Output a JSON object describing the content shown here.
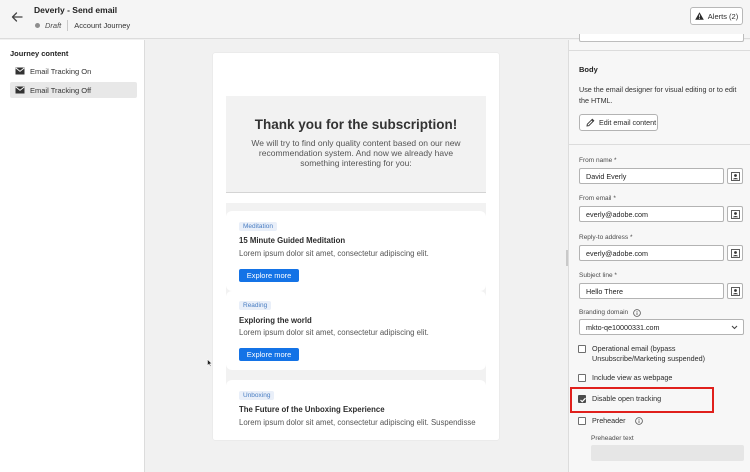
{
  "header": {
    "title": "Deverly - Send email",
    "status": "Draft",
    "journey": "Account Journey",
    "alerts_label": "Alerts (2)"
  },
  "left_panel": {
    "title": "Journey content",
    "items": [
      {
        "label": "Email Tracking On",
        "icon": "mail-icon",
        "selected": false
      },
      {
        "label": "Email Tracking Off",
        "icon": "mail-icon",
        "selected": true
      }
    ]
  },
  "email": {
    "hero_title": "Thank you for the subscription!",
    "hero_text": "We will try to find only quality content based on our new recommendation system. And now we already have something interesting for you:",
    "articles": [
      {
        "tag": "Meditation",
        "title": "15 Minute Guided Meditation",
        "text": "Lorem ipsum dolor sit amet, consectetur adipiscing elit.",
        "button": "Explore more"
      },
      {
        "tag": "Reading",
        "title": "Exploring the world",
        "text": "Lorem ipsum dolor sit amet, consectetur adipiscing elit.",
        "button": "Explore more"
      },
      {
        "tag": "Unboxing",
        "title": "The Future of the Unboxing Experience",
        "text": "Lorem ipsum dolor sit amet, consectetur adipiscing elit. Suspendisse"
      }
    ]
  },
  "right_panel": {
    "body_title": "Body",
    "body_desc": "Use the email designer for visual editing or to edit the HTML.",
    "edit_button": "Edit email content",
    "from_name_label": "From name",
    "from_name_value": "David Everly",
    "from_email_label": "From email",
    "from_email_value": "everly@adobe.com",
    "reply_to_label": "Reply-to address",
    "reply_to_value": "everly@adobe.com",
    "subject_label": "Subject line",
    "subject_value": "Hello There",
    "branding_label": "Branding domain",
    "branding_value": "mkto-qe10000331.com",
    "required_mark": "*",
    "checkboxes": {
      "operational_line1": "Operational email (bypass",
      "operational_line2": "Unsubscribe/Marketing suspended)",
      "include_view": "Include view as webpage",
      "disable_tracking": "Disable open tracking",
      "preheader": "Preheader"
    },
    "checked": {
      "operational": false,
      "include_view": false,
      "disable_tracking": true,
      "preheader": false
    },
    "preheader_text_label": "Preheader text"
  },
  "colors": {
    "accent": "#1473e6",
    "highlight": "#e0201c",
    "tag_text": "#4a7ec2"
  }
}
